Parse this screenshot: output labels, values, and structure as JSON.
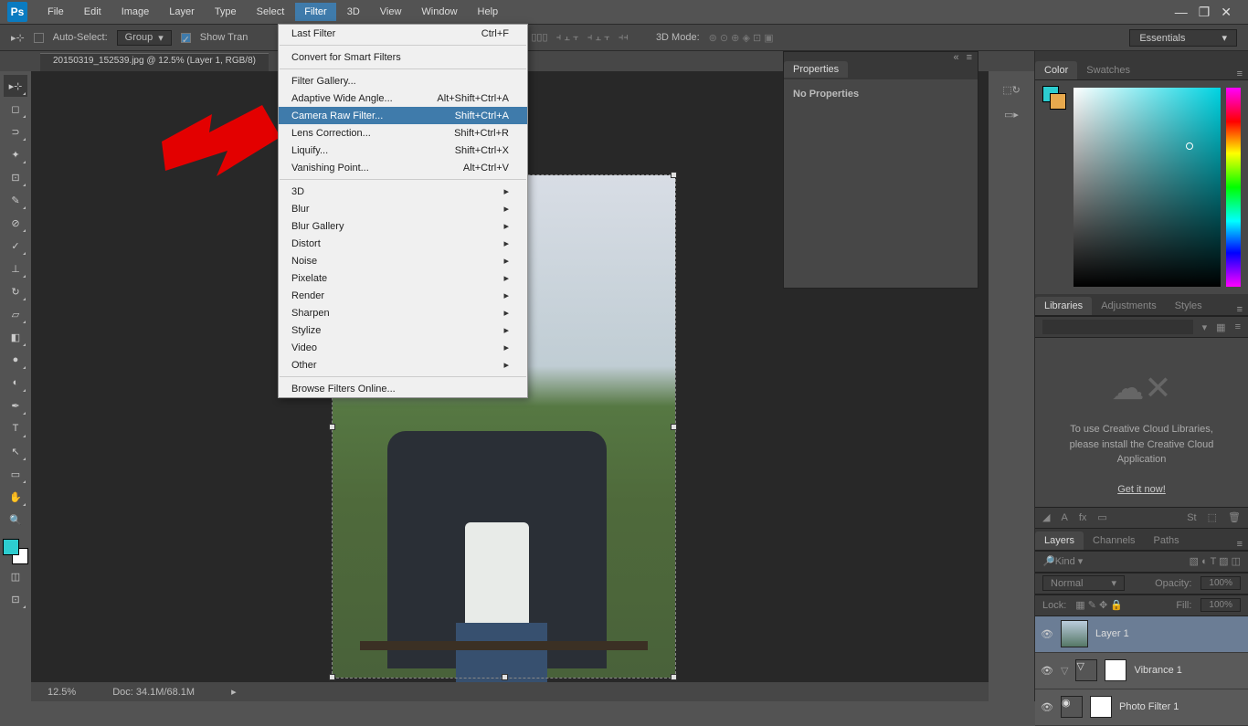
{
  "app": {
    "logo": "Ps"
  },
  "menubar": [
    "File",
    "Edit",
    "Image",
    "Layer",
    "Type",
    "Select",
    "Filter",
    "3D",
    "View",
    "Window",
    "Help"
  ],
  "menubar_open": "Filter",
  "options": {
    "auto_select": "Auto-Select:",
    "group": "Group",
    "show_tran": "Show Tran",
    "mode_3d": "3D Mode:"
  },
  "doc_tab": "20150319_152539.jpg @ 12.5% (Layer 1, RGB/8)",
  "workspace": "Essentials",
  "dropdown": {
    "last_filter": {
      "label": "Last Filter",
      "kb": "Ctrl+F"
    },
    "convert": "Convert for Smart Filters",
    "filter_gallery": "Filter Gallery...",
    "adaptive": {
      "label": "Adaptive Wide Angle...",
      "kb": "Alt+Shift+Ctrl+A"
    },
    "camera_raw": {
      "label": "Camera Raw Filter...",
      "kb": "Shift+Ctrl+A"
    },
    "lens": {
      "label": "Lens Correction...",
      "kb": "Shift+Ctrl+R"
    },
    "liquify": {
      "label": "Liquify...",
      "kb": "Shift+Ctrl+X"
    },
    "vanishing": {
      "label": "Vanishing Point...",
      "kb": "Alt+Ctrl+V"
    },
    "subs": [
      "3D",
      "Blur",
      "Blur Gallery",
      "Distort",
      "Noise",
      "Pixelate",
      "Render",
      "Sharpen",
      "Stylize",
      "Video",
      "Other"
    ],
    "browse": "Browse Filters Online..."
  },
  "properties": {
    "title": "Properties",
    "body": "No Properties"
  },
  "panels": {
    "color": "Color",
    "swatches": "Swatches",
    "libraries": "Libraries",
    "adjustments": "Adjustments",
    "styles": "Styles",
    "layers": "Layers",
    "channels": "Channels",
    "paths": "Paths"
  },
  "libraries": {
    "msg1": "To use Creative Cloud Libraries,",
    "msg2": "please install the Creative Cloud",
    "msg3": "Application",
    "link": "Get it now!"
  },
  "layers": {
    "kind": "Kind",
    "normal": "Normal",
    "opacity_l": "Opacity:",
    "opacity_v": "100%",
    "lock": "Lock:",
    "fill_l": "Fill:",
    "fill_v": "100%",
    "l1": "Layer 1",
    "l2": "Vibrance 1",
    "l3": "Photo Filter 1"
  },
  "status": {
    "zoom": "12.5%",
    "doc": "Doc:  34.1M/68.1M"
  }
}
